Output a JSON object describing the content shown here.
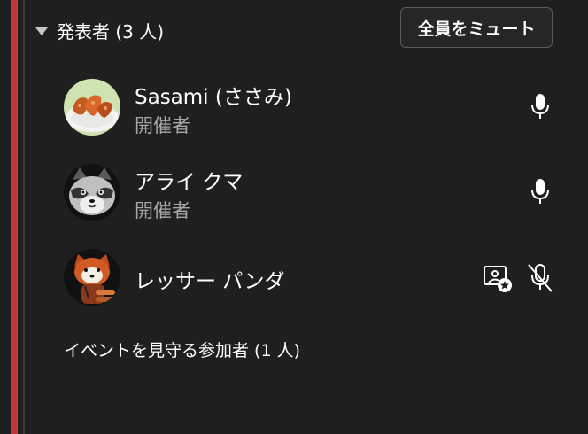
{
  "presenters_section": {
    "title": "発表者 (3 人)",
    "mute_all_label": "全員をミュート"
  },
  "participants": [
    {
      "name": "Sasami (ささみ)",
      "role": "開催者",
      "mic": "mic-icon",
      "avatar": "fried-food-avatar"
    },
    {
      "name": "アライ クマ",
      "role": "開催者",
      "mic": "mic-icon",
      "avatar": "raccoon-avatar"
    },
    {
      "name": "レッサー パンダ",
      "role": "",
      "mic": "mic-off-icon",
      "extra_icon": "spotlight-icon",
      "avatar": "red-panda-avatar"
    }
  ],
  "attendees_section": {
    "title": "イベントを見守る参加者 (1 人)"
  }
}
